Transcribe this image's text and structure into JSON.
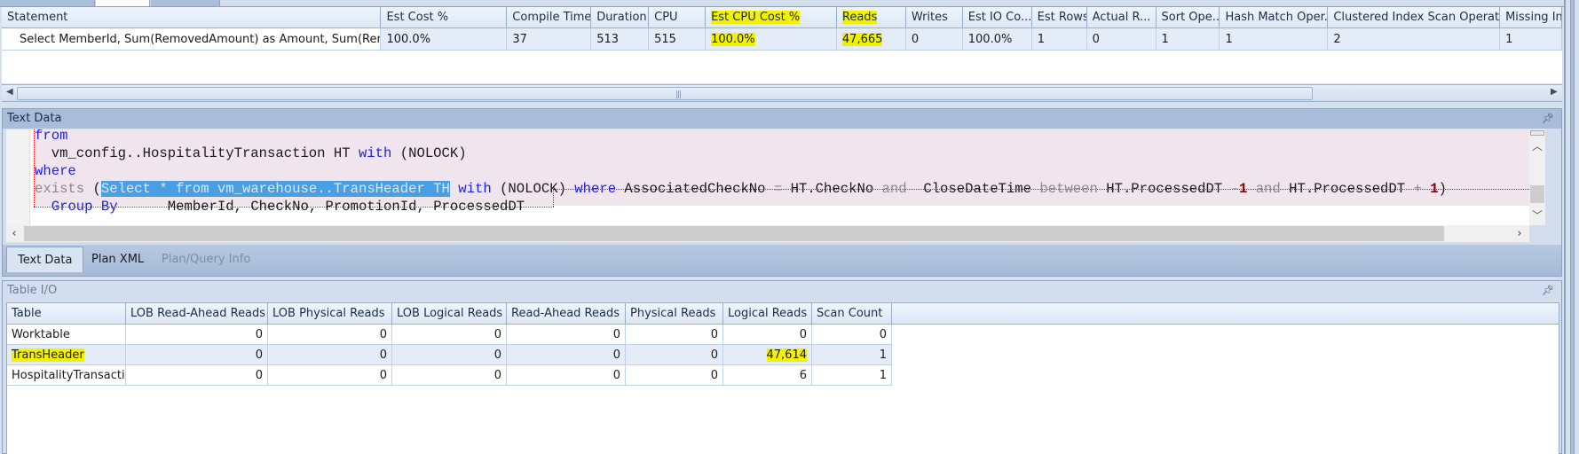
{
  "statements_grid": {
    "columns": [
      "Statement",
      "Est Cost %",
      "Compile Time",
      "Duration",
      "CPU",
      "Est CPU Cost %",
      "Reads",
      "Writes",
      "Est IO Co...",
      "Est Rows",
      "Actual R...",
      "Sort Ope...",
      "Hash Match Oper...",
      "Clustered Index Scan Operatio...",
      "Missing Inc"
    ],
    "rows": [
      [
        "Select MemberId, Sum(RemovedAmount) as Amount, Sum(Remov...",
        "100.0%",
        "37",
        "513",
        "515",
        "100.0%",
        "47,665",
        "0",
        "100.0%",
        "1",
        "0",
        "1",
        "1",
        "2",
        "1"
      ]
    ],
    "highlighted_columns": [
      "Est CPU Cost %",
      "Reads"
    ],
    "highlight_color": "#f2f200"
  },
  "text_data_panel": {
    "title": "Text Data",
    "code_lines": [
      [
        {
          "t": "from",
          "c": "kw"
        }
      ],
      [
        {
          "t": "  vm_config..HospitalityTransaction HT ",
          "c": ""
        },
        {
          "t": "with",
          "c": "kw"
        },
        {
          "t": " (NOLOCK)",
          "c": ""
        }
      ],
      [
        {
          "t": "where",
          "c": "kw"
        }
      ],
      [
        {
          "t": "exists",
          "c": "gr"
        },
        {
          "t": " (",
          "c": ""
        },
        {
          "t": "Select * from vm_warehouse..TransHeader TH",
          "c": "sel"
        },
        {
          "t": " ",
          "c": ""
        },
        {
          "t": "with",
          "c": "kw"
        },
        {
          "t": " (NOLOCK) ",
          "c": ""
        },
        {
          "t": "where",
          "c": "kw"
        },
        {
          "t": " AssociatedCheckNo ",
          "c": ""
        },
        {
          "t": "=",
          "c": "gr"
        },
        {
          "t": " HT.CheckNo ",
          "c": ""
        },
        {
          "t": "and",
          "c": "gr"
        },
        {
          "t": "  CloseDateTime ",
          "c": ""
        },
        {
          "t": "between",
          "c": "gr"
        },
        {
          "t": " HT.ProcessedDT ",
          "c": ""
        },
        {
          "t": "-",
          "c": "gr"
        },
        {
          "t": "1",
          "c": "num"
        },
        {
          "t": " ",
          "c": ""
        },
        {
          "t": "and",
          "c": "gr"
        },
        {
          "t": " HT.ProcessedDT ",
          "c": ""
        },
        {
          "t": "+",
          "c": "gr"
        },
        {
          "t": " ",
          "c": ""
        },
        {
          "t": "1",
          "c": "num"
        },
        {
          "t": ")",
          "c": ""
        }
      ],
      [
        {
          "t": "  ",
          "c": ""
        },
        {
          "t": "Group By",
          "c": "kw"
        },
        {
          "t": "      MemberId, CheckNo, PromotionId, ProcessedDT",
          "c": ""
        }
      ]
    ],
    "tabs": [
      {
        "label": "Text Data",
        "state": "active"
      },
      {
        "label": "Plan XML",
        "state": "normal"
      },
      {
        "label": "Plan/Query Info",
        "state": "disabled"
      }
    ]
  },
  "table_io_panel": {
    "title": "Table I/O",
    "columns": [
      "Table",
      "LOB Read-Ahead Reads",
      "LOB Physical Reads",
      "LOB Logical Reads",
      "Read-Ahead Reads",
      "Physical Reads",
      "Logical Reads",
      "Scan Count"
    ],
    "rows": [
      [
        "Worktable",
        "0",
        "0",
        "0",
        "0",
        "0",
        "0",
        "0"
      ],
      [
        "TransHeader",
        "0",
        "0",
        "0",
        "0",
        "0",
        "47,614",
        "1"
      ],
      [
        "HospitalityTransaction",
        "0",
        "0",
        "0",
        "0",
        "0",
        "6",
        "1"
      ]
    ],
    "highlighted_cells": [
      "TransHeader",
      "47,614"
    ]
  },
  "icons": {
    "pin": "pin-icon",
    "scroll_left": "scroll-left-icon",
    "scroll_right": "scroll-right-icon",
    "scroll_up": "scroll-up-icon",
    "scroll_down": "scroll-down-icon"
  }
}
